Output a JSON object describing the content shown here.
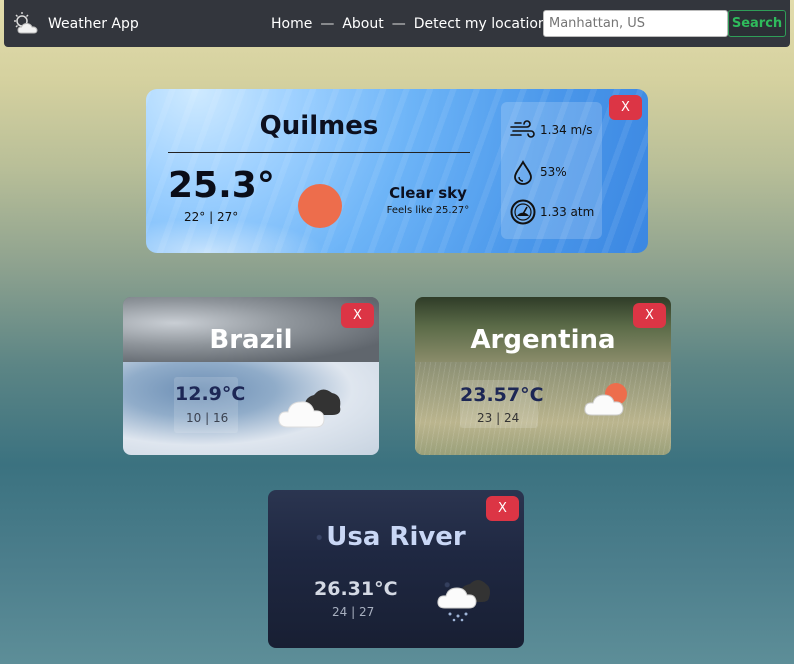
{
  "navbar": {
    "brand": "Weather App",
    "links": [
      "Home",
      "About",
      "Detect my location"
    ],
    "separator": "—",
    "search_placeholder": "Manhattan, US",
    "search_label": "Search"
  },
  "main": {
    "city": "Quilmes",
    "temp": "25.3°",
    "range": "22° | 27°",
    "description": "Clear sky",
    "feels_like": "Feels like 25.27°",
    "wind": "1.34 m/s",
    "humidity": "53%",
    "pressure": "1.33 atm",
    "close_label": "X"
  },
  "cards": [
    {
      "city": "Brazil",
      "temp": "12.9°C",
      "range": "10 | 16",
      "icon": "cloudy-icon",
      "close_label": "X"
    },
    {
      "city": "Argentina",
      "temp": "23.57°C",
      "range": "23 | 24",
      "icon": "partly-cloudy-icon",
      "close_label": "X"
    },
    {
      "city": "Usa River",
      "temp": "26.31°C",
      "range": "24 | 27",
      "icon": "rain-cloud-icon",
      "close_label": "X"
    }
  ],
  "colors": {
    "navbar": "#33363d",
    "search_accent": "#2fbb5c",
    "close_button": "#dc3545",
    "sun": "#ed6d4c"
  }
}
